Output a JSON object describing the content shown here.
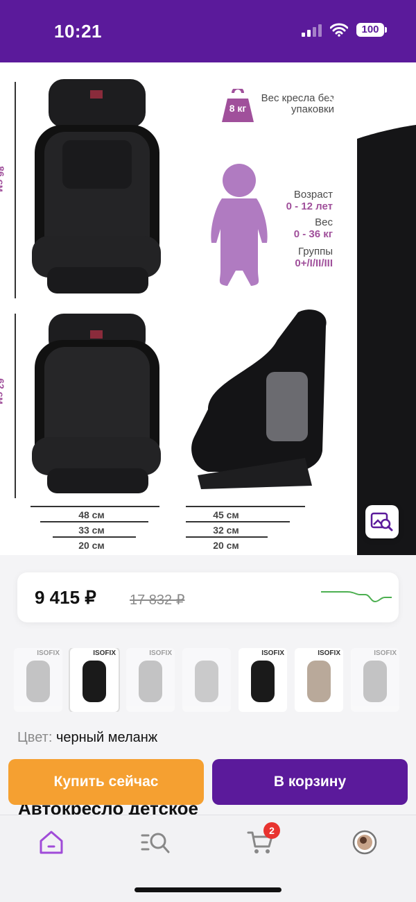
{
  "status_bar": {
    "time": "10:21",
    "battery": "100"
  },
  "gallery": {
    "weight_badge": "8 кг",
    "weight_caption": "Вес кресла без упаковки",
    "specs": [
      {
        "label": "Возраст",
        "value": "0 - 12 лет"
      },
      {
        "label": "Вес",
        "value": "0 - 36 кг"
      },
      {
        "label": "Группы",
        "value": "0+/I/II/III"
      }
    ],
    "height_top": "86 см",
    "height_bottom": "62 см",
    "front_dims": [
      "48 см",
      "33 см",
      "20 см"
    ],
    "side_dims": [
      "45 см",
      "32 см",
      "20 см"
    ],
    "icons": {
      "back": "chevron-left-icon",
      "favorite": "heart-icon",
      "share": "share-icon",
      "image_search": "image-search-icon"
    }
  },
  "price": {
    "current": "9 415 ₽",
    "old": "17 832 ₽",
    "trend_color": "#4caf50"
  },
  "thumbnails": [
    {
      "label": "ISOFIX",
      "faded": true
    },
    {
      "label": "ISOFIX",
      "faded": false
    },
    {
      "label": "ISOFIX",
      "faded": true
    },
    {
      "label": "",
      "faded": true
    },
    {
      "label": "ISOFIX",
      "faded": false
    },
    {
      "label": "ISOFIX",
      "faded": false
    },
    {
      "label": "ISOFIX",
      "faded": true
    }
  ],
  "color": {
    "label": "Цвет:",
    "value": "черный меланж"
  },
  "actions": {
    "buy_now": "Купить сейчас",
    "add_to_cart": "В корзину"
  },
  "product_title": "Автокресло детское",
  "tab_bar": {
    "cart_count": "2",
    "icons": [
      "home-icon",
      "catalog-search-icon",
      "cart-icon",
      "profile-avatar"
    ]
  },
  "colors": {
    "brand": "#5b1a9b",
    "accent": "#f5a031",
    "spec": "#a0509b",
    "badge": "#e8332f"
  }
}
